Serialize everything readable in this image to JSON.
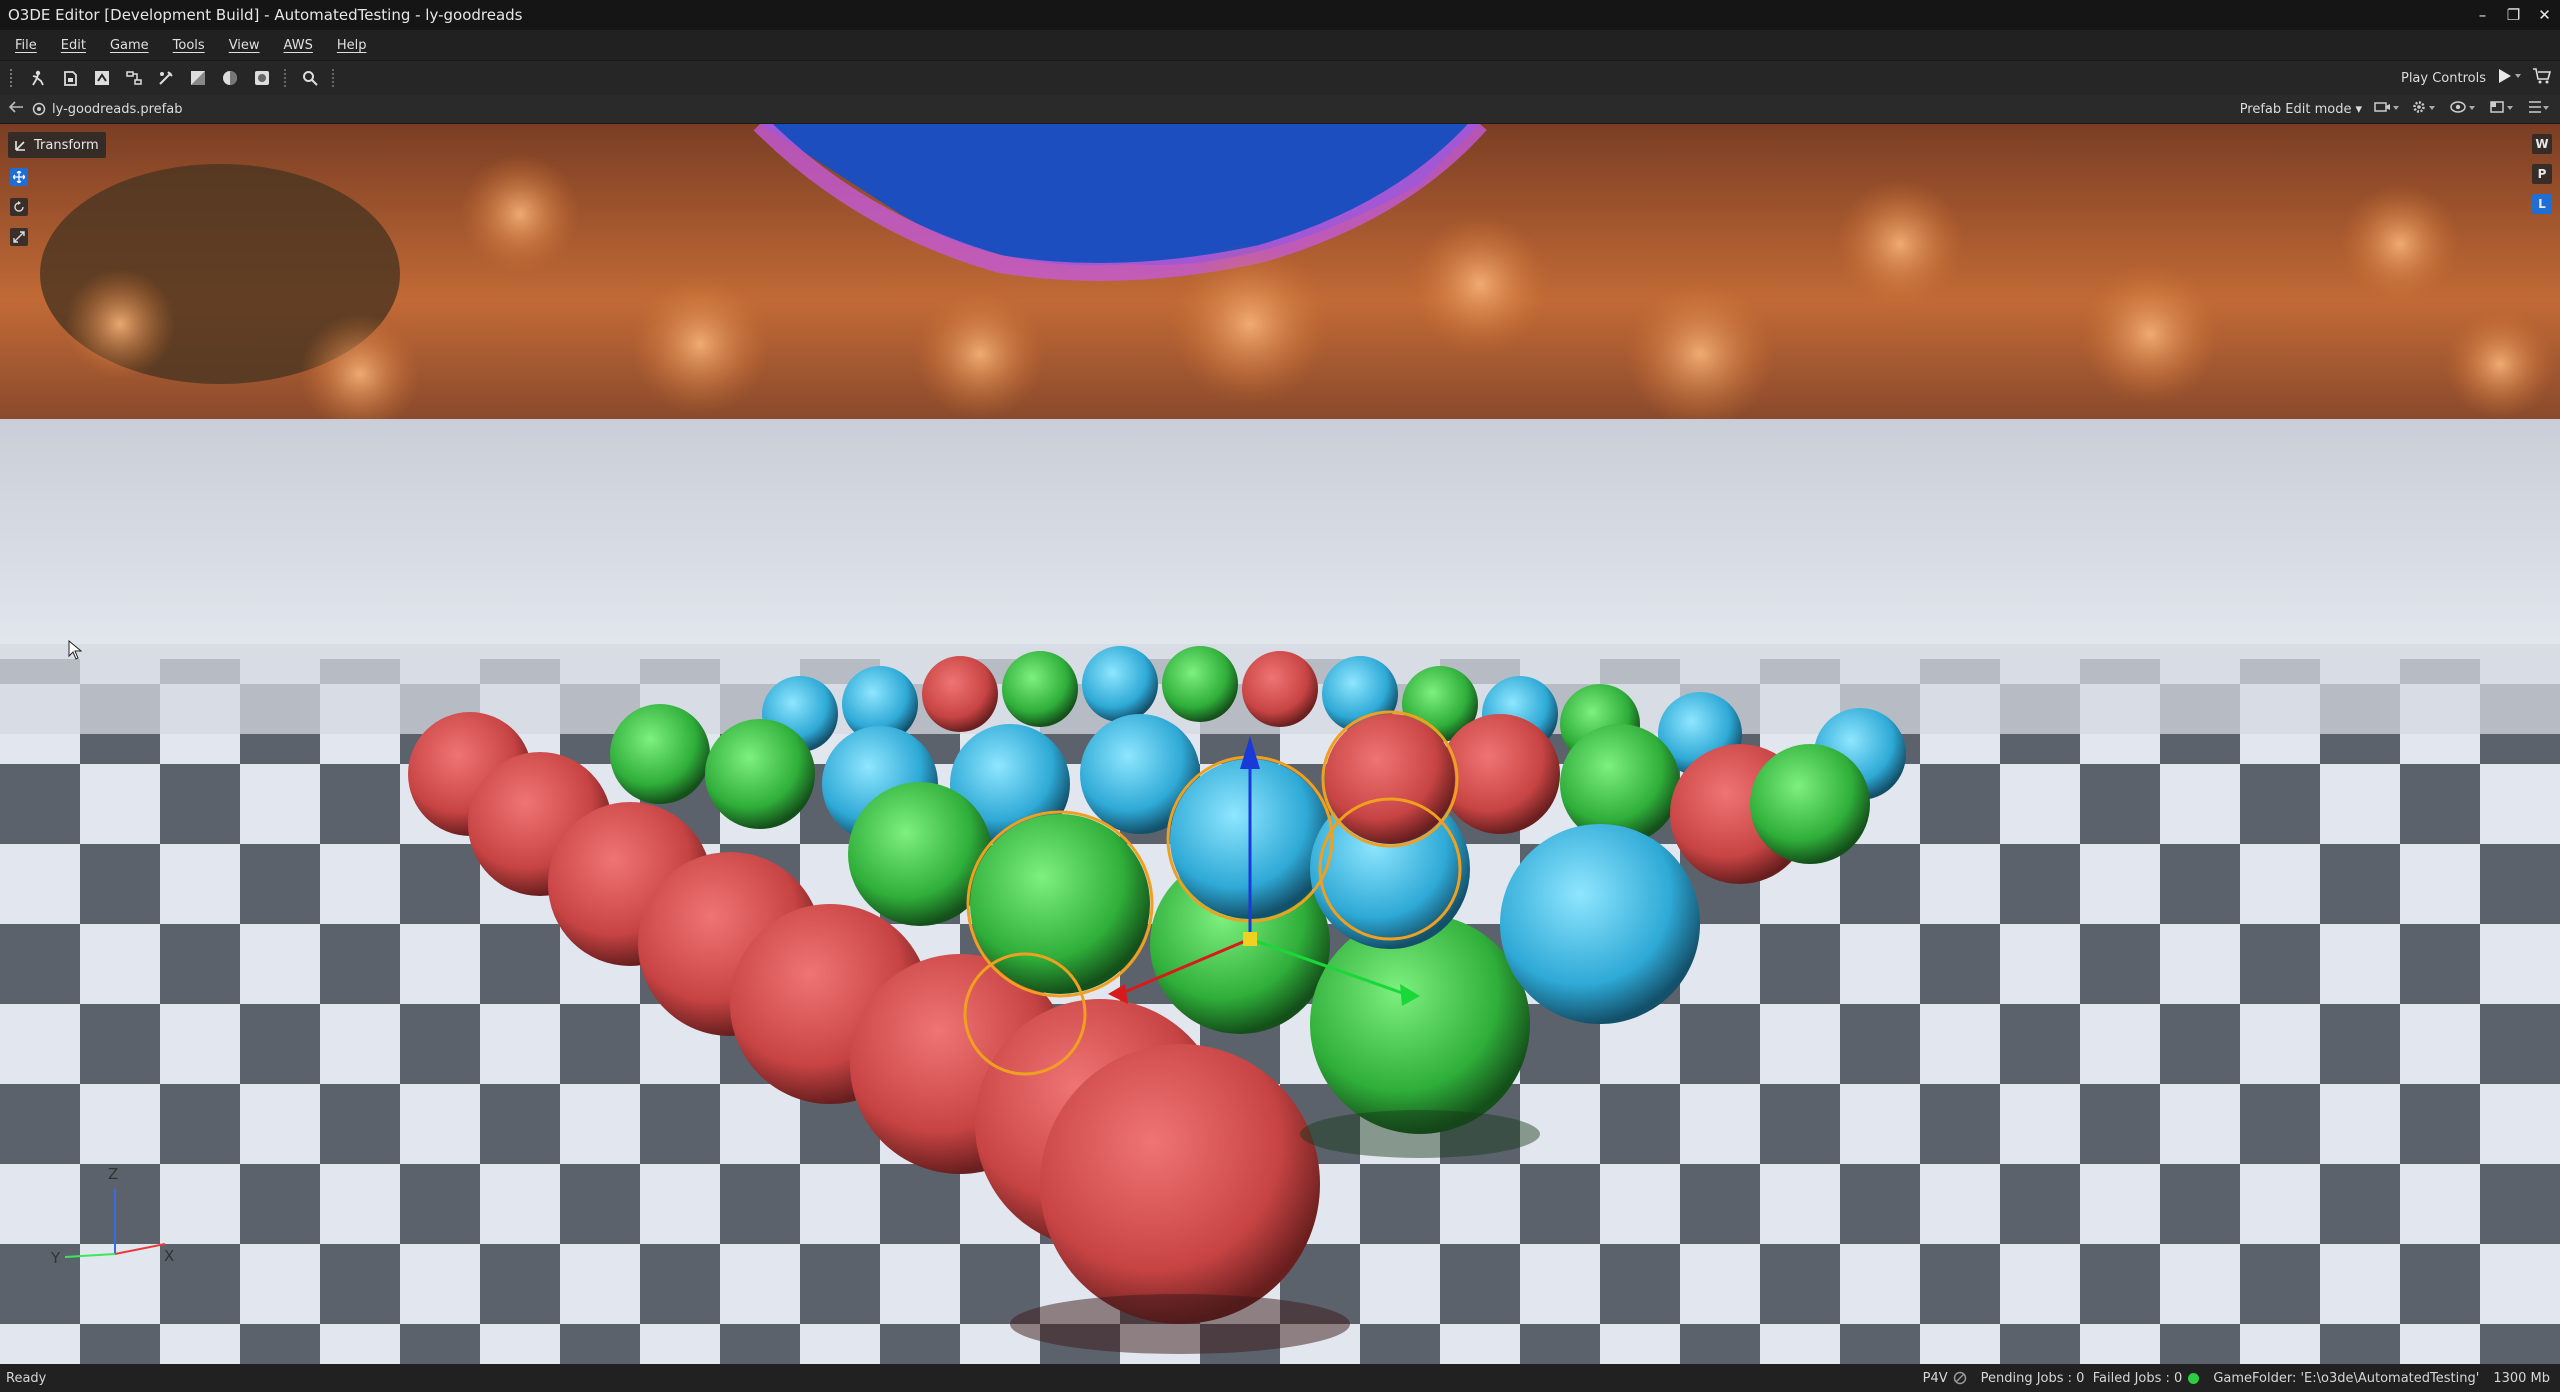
{
  "window": {
    "title": "O3DE Editor [Development Build] - AutomatedTesting - ly-goodreads",
    "controls": [
      "–",
      "❐",
      "✕"
    ]
  },
  "menu": [
    "File",
    "Edit",
    "Game",
    "Tools",
    "View",
    "AWS",
    "Help"
  ],
  "toolbar": {
    "icons": [
      "entity-outliner-icon",
      "asset-browser-icon",
      "inspector-icon",
      "script-canvas-icon",
      "track-view-icon",
      "material-editor-icon",
      "lighting-icon",
      "terrain-icon",
      "search-icon"
    ],
    "play_label": "Play Controls"
  },
  "breadcrumb": {
    "file": "ly-goodreads.prefab",
    "mode": "Prefab Edit mode"
  },
  "viewport": {
    "transform_label": "Transform",
    "space_buttons": [
      "W",
      "P",
      "L"
    ],
    "axes": {
      "z": "Z",
      "y": "Y",
      "x": "X"
    }
  },
  "status": {
    "left": "Ready",
    "p4v": "P4V",
    "jobs": "Pending Jobs : 0  Failed Jobs : 0",
    "game_folder": "GameFolder: 'E:\\o3de\\AutomatedTesting'",
    "memory": "1300 Mb"
  },
  "colors": {
    "accent": "#1f6ed4",
    "status_ok": "#2ecc40",
    "selection": "#f0a020"
  }
}
